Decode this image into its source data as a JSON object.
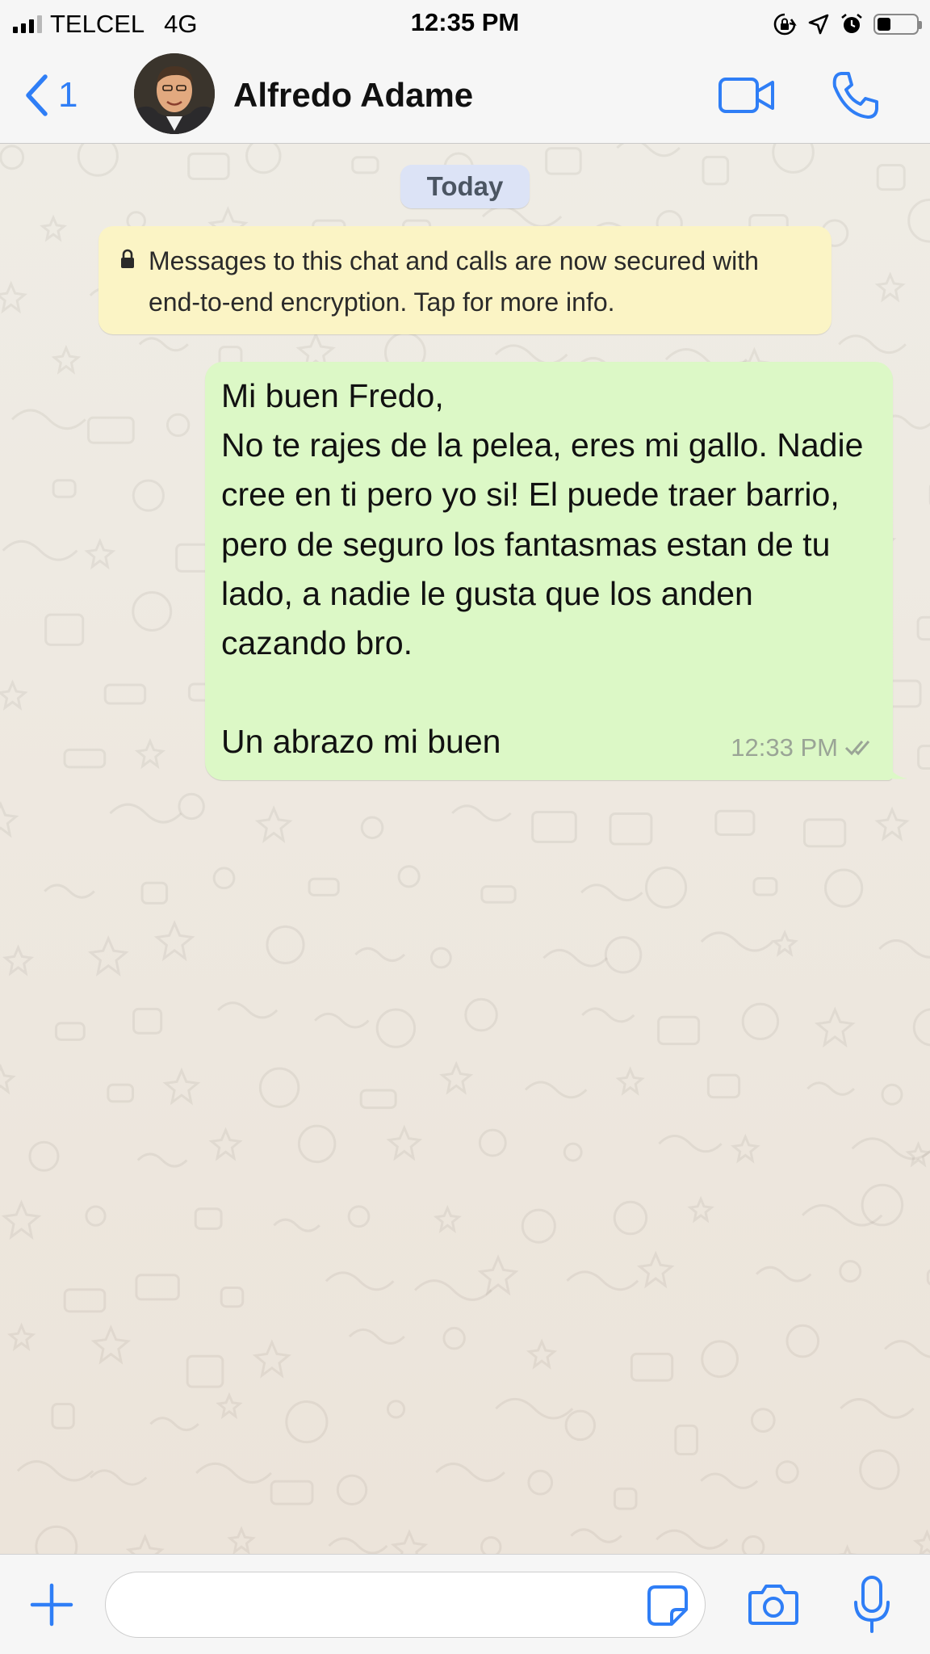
{
  "status_bar": {
    "carrier": "TELCEL",
    "network": "4G",
    "time": "12:35 PM",
    "icons": [
      "signal-icon",
      "orientation-lock-icon",
      "location-arrow-icon",
      "alarm-clock-icon",
      "battery-icon"
    ],
    "battery_level": 0.35
  },
  "header": {
    "back_count": "1",
    "contact_name": "Alfredo Adame",
    "icons": [
      "chevron-left-icon",
      "video-call-icon",
      "phone-call-icon"
    ]
  },
  "chat": {
    "date_label": "Today",
    "encryption_notice": "Messages to this chat and calls are now secured with end-to-end encryption. Tap for more info.",
    "messages": [
      {
        "direction": "outgoing",
        "text": "Mi buen Fredo,\nNo te rajes de la pelea, eres mi gallo. Nadie cree en ti pero yo si! El puede traer barrio, pero de seguro los fantasmas estan de tu lado, a nadie le gusta que los anden cazando bro.\n\nUn abrazo mi buen",
        "time": "12:33 PM",
        "status": "delivered"
      }
    ]
  },
  "input_bar": {
    "value": "",
    "placeholder": "",
    "icons": [
      "plus-icon",
      "sticker-icon",
      "camera-icon",
      "microphone-icon"
    ]
  },
  "colors": {
    "accent": "#2f7ef6",
    "outgoing_bubble": "#dcf8c6",
    "notice_bg": "#fbf4c5",
    "date_pill_bg": "#dce3f6",
    "chat_bg": "#ece5dd",
    "bar_bg": "#f6f6f6"
  }
}
